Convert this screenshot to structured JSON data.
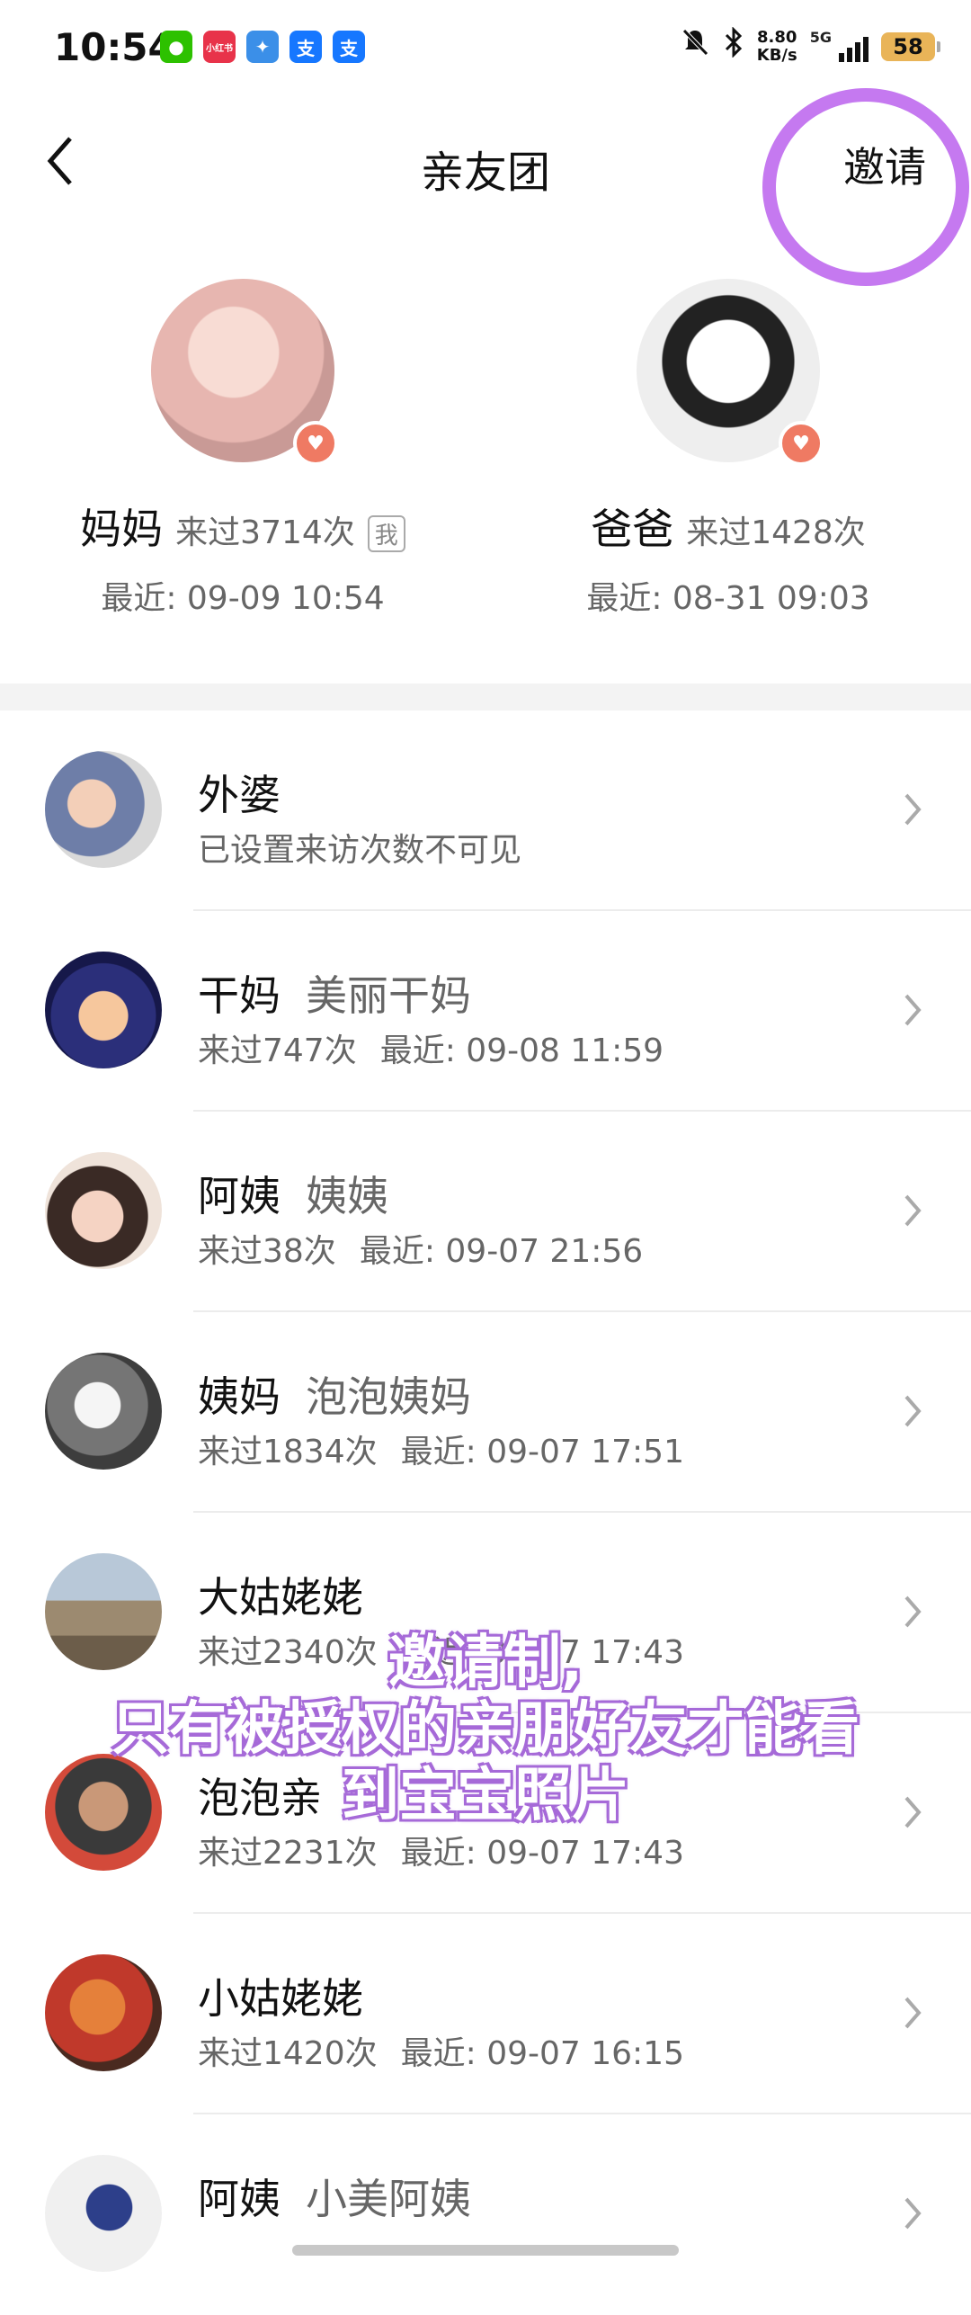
{
  "status_bar": {
    "time": "10:54",
    "apps": [
      {
        "icon": "wechat-icon",
        "label": "",
        "color": "#2dc100"
      },
      {
        "icon": "xiaohongshu-icon",
        "label": "小红书",
        "color": "#e8334a"
      },
      {
        "icon": "bird-app-icon",
        "label": "",
        "color": "#3b8fe8"
      },
      {
        "icon": "alipay-icon",
        "label": "支",
        "color": "#1677ff"
      },
      {
        "icon": "alipay-icon",
        "label": "支",
        "color": "#1677ff"
      }
    ],
    "net_speed_value": "8.80",
    "net_speed_unit": "KB/s",
    "network": "5G",
    "battery": "58"
  },
  "nav": {
    "title": "亲友团",
    "invite_label": "邀请"
  },
  "parents": [
    {
      "name": "妈妈",
      "visits": "来过3714次",
      "tag": "我",
      "recent": "最近: 09-09 10:54"
    },
    {
      "name": "爸爸",
      "visits": "来过1428次",
      "tag": "",
      "recent": "最近: 08-31 09:03"
    }
  ],
  "members": [
    {
      "name": "外婆",
      "nickname": "",
      "visits": "已设置来访次数不可见",
      "recent": ""
    },
    {
      "name": "干妈",
      "nickname": "美丽干妈",
      "visits": "来过747次",
      "recent": "最近: 09-08 11:59"
    },
    {
      "name": "阿姨",
      "nickname": "姨姨",
      "visits": "来过38次",
      "recent": "最近: 09-07 21:56"
    },
    {
      "name": "姨妈",
      "nickname": "泡泡姨妈",
      "visits": "来过1834次",
      "recent": "最近: 09-07 17:51"
    },
    {
      "name": "大姑姥姥",
      "nickname": "",
      "visits": "来过2340次",
      "recent": "最近: 09-07 17:43"
    },
    {
      "name": "泡泡亲",
      "nickname": "",
      "visits": "来过2231次",
      "recent": "最近: 09-07 17:43"
    },
    {
      "name": "小姑姥姥",
      "nickname": "",
      "visits": "来过1420次",
      "recent": "最近: 09-07 16:15"
    },
    {
      "name": "阿姨",
      "nickname": "小美阿姨",
      "visits": "",
      "recent": ""
    }
  ],
  "caption": {
    "line1": "邀请制,",
    "line2": "只有被授权的亲朋好友才能看",
    "line3": "到宝宝照片"
  },
  "colors": {
    "highlight_circle": "#c579f0",
    "heart_badge": "#ef7a63",
    "caption_outline": "#a66ad8"
  }
}
